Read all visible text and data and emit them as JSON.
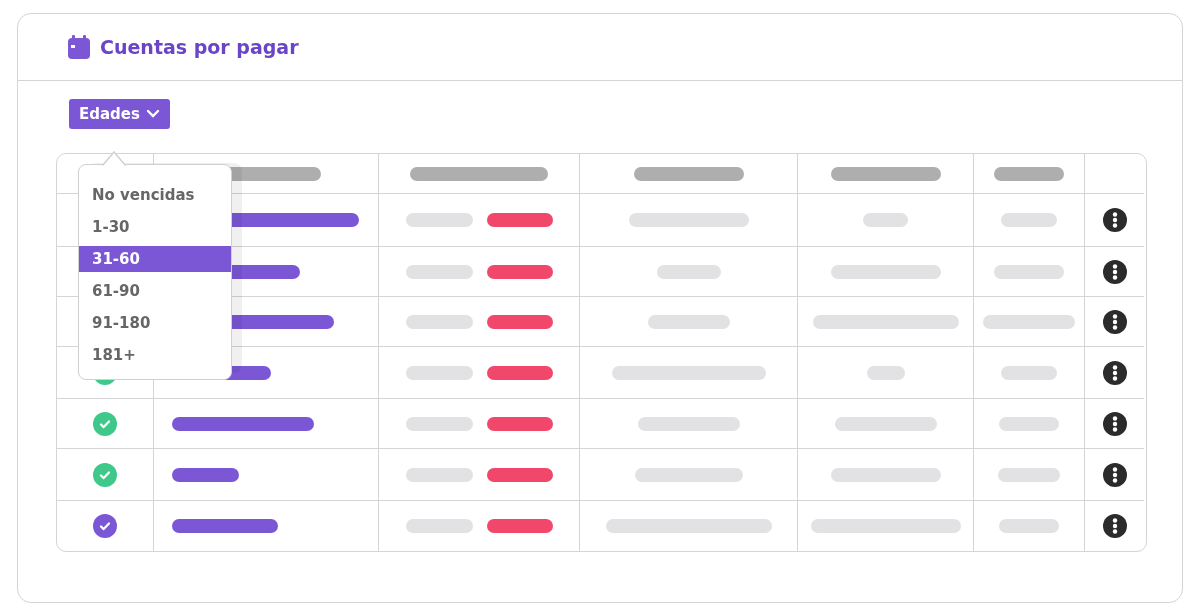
{
  "header": {
    "title": "Cuentas por pagar"
  },
  "filter": {
    "label": "Edades",
    "expanded": true,
    "options": [
      {
        "label": "No vencidas",
        "selected": false
      },
      {
        "label": "1-30",
        "selected": false
      },
      {
        "label": "31-60",
        "selected": true
      },
      {
        "label": "61-90",
        "selected": false
      },
      {
        "label": "91-180",
        "selected": false
      },
      {
        "label": "181+",
        "selected": false
      }
    ]
  },
  "table": {
    "rows": [
      {
        "kind": "covered"
      },
      {
        "kind": "covered"
      },
      {
        "kind": "covered"
      },
      {
        "kind": "dot",
        "color": "#3ec98a"
      },
      {
        "kind": "dot",
        "color": "#3ec98a"
      },
      {
        "kind": "dot",
        "color": "#3ec98a"
      },
      {
        "kind": "dot",
        "color": "#7b57d6"
      }
    ]
  }
}
